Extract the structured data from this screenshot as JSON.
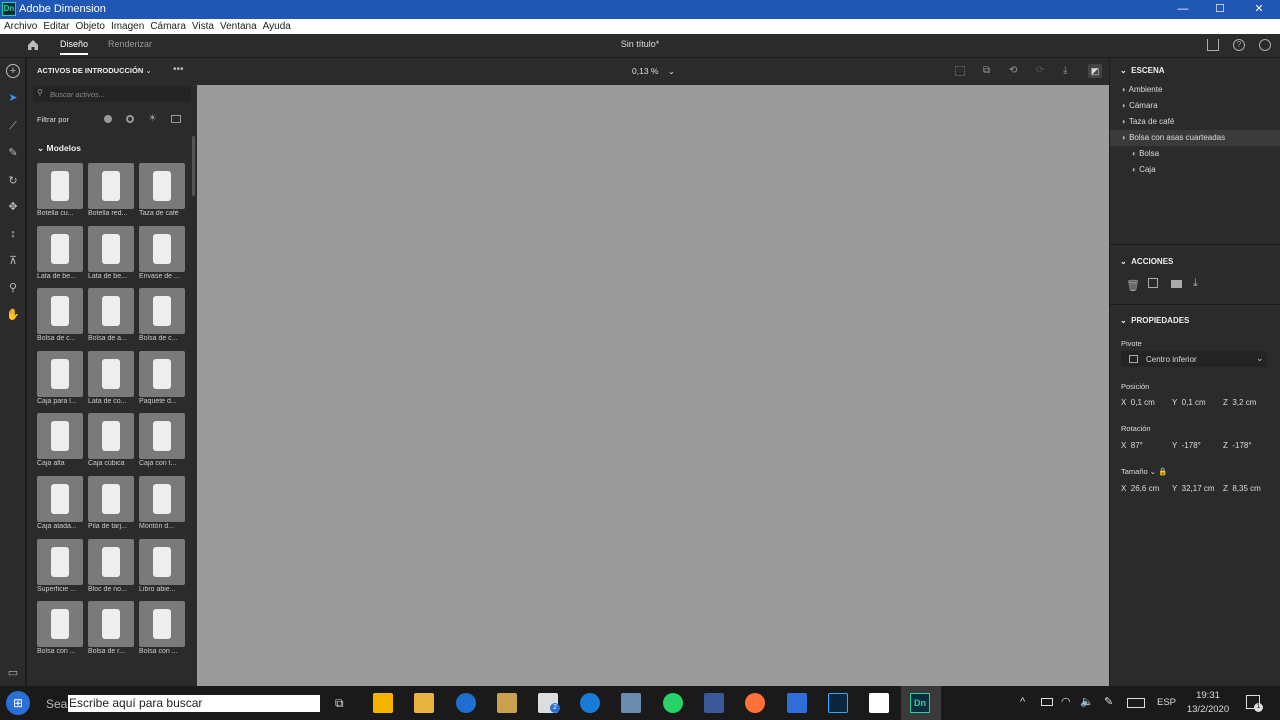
{
  "window": {
    "title": "Adobe Dimension",
    "logo": "Dn",
    "controls": [
      "—",
      "☐",
      "✕"
    ]
  },
  "menu": [
    "Archivo",
    "Editar",
    "Objeto",
    "Imagen",
    "Cámara",
    "Vista",
    "Ventana",
    "Ayuda"
  ],
  "header": {
    "tabs": [
      "Diseño",
      "Renderizar"
    ],
    "doc_title": "Sin título*"
  },
  "assets": {
    "title": "ACTIVOS DE INTRODUCCIÓN",
    "search_placeholder": "Buscar activos...",
    "filter_label": "Filtrar por",
    "section": "Modelos",
    "items": [
      "Botella cu...",
      "Botella red...",
      "Taza de café",
      "Lata de be...",
      "Lata de be...",
      "Envase de ...",
      "Bolsa de c...",
      "Bolsa de a...",
      "Bolsa de c...",
      "Caja para l...",
      "Lata de co...",
      "Paquete d...",
      "Caja alta",
      "Caja cúbica",
      "Caja con t...",
      "Caja atada...",
      "Pila de tarj...",
      "Montón d...",
      "Superficie ...",
      "Bloc de no...",
      "Libro abie...",
      "Bolsa con ...",
      "Bolsa de r...",
      "Bolsa con ..."
    ]
  },
  "viewport": {
    "zoom": "0,13 %"
  },
  "scene": {
    "title": "ESCENA",
    "items": [
      {
        "label": "Ambiente",
        "icon": "environment-icon",
        "indent": 0
      },
      {
        "label": "Cámara",
        "icon": "camera-icon",
        "indent": 0
      },
      {
        "label": "Taza de café",
        "icon": "folder-icon",
        "indent": 0
      },
      {
        "label": "Bolsa con asas cuarteadas",
        "icon": "folder-icon",
        "indent": 0,
        "selected": true
      },
      {
        "label": "Bolsa",
        "icon": "model-icon",
        "indent": 1
      },
      {
        "label": "Caja",
        "icon": "model-icon",
        "indent": 1
      }
    ]
  },
  "actions": {
    "title": "ACCIONES"
  },
  "properties": {
    "title": "PROPIEDADES",
    "pivot_label": "Pivote",
    "pivot_value": "Centro inferior",
    "position_label": "Posición",
    "position": {
      "x": "0,1 cm",
      "y": "0,1 cm",
      "z": "3,2 cm"
    },
    "rotation_label": "Rotación",
    "rotation": {
      "x": "87°",
      "y": "-178°",
      "z": "-178°"
    },
    "size_label": "Tamaño",
    "size": {
      "x": "26,6 cm",
      "y": "32,17 cm",
      "z": "8,35 cm"
    }
  },
  "taskbar": {
    "search_prefix": "Sear",
    "search_text": "Escribe aquí para buscar",
    "lang": "ESP",
    "time": "19:31",
    "date": "13/2/2020",
    "mail_badge": "2",
    "notif_badge": "1"
  },
  "colors": {
    "accent": "#2057b4",
    "panel": "#2b2b2b",
    "viewport": "#9b9b9b",
    "dn": "#2bd0a0"
  }
}
